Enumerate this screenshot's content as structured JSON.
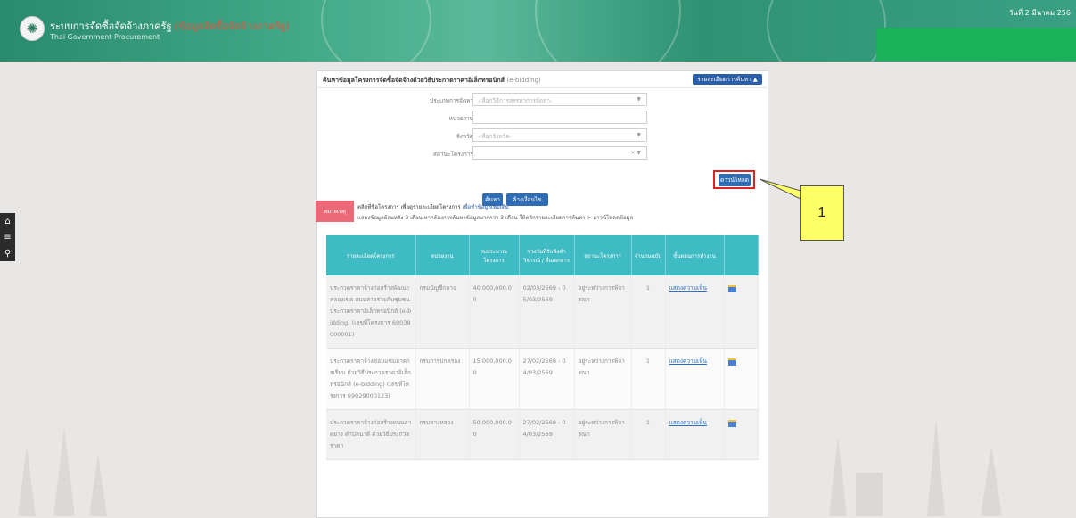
{
  "header": {
    "title_main": "ระบบการจัดซื้อจัดจ้างภาครัฐ",
    "title_red": "(ข้อมูลจัดซื้อจัดจ้างภาครัฐ)",
    "subtitle": "Thai Government Procurement",
    "date": "วันที่ 2 มีนาคม 256"
  },
  "sidenav": {
    "icons": [
      "home-icon",
      "menu-icon",
      "search-icon"
    ]
  },
  "panel": {
    "title": "ค้นหาข้อมูลโครงการจัดซื้อจัดจ้างด้วยวิธีประกวดราคาอิเล็กทรอนิกส์",
    "title_suffix": "(e-bidding)",
    "toggle_label": "รายละเอียดการค้นหา ▲",
    "form": {
      "method_label": "ประเภทการจัดหา",
      "method_placeholder": "-เลือกวิธีการสรรหาการจัดหา-",
      "agency_label": "หน่วยงาน",
      "agency_value": "",
      "province_label": "จังหวัด",
      "province_placeholder": "-เลือกจังหวัด-",
      "status_label": "สถานะโครงการ",
      "status_value": ""
    },
    "search_label": "ค้นหา",
    "clear_label": "ล้างเงื่อนไข",
    "download_label": "ดาวน์โหลด",
    "note_tag": "หมายเหตุ",
    "note_line1_a": "คลิกที่ชื่อโครงการ",
    "note_line1_b": "เพื่อดูรายละเอียดโครงการ",
    "note_line1_c": "เพื่อทำข้อมูลเพิ่มเติม",
    "note_line2": "แสดงข้อมูลย้อนหลัง 3 เดือน หากต้องการค้นหาข้อมูลมากกว่า 3 เดือน ให้คลิกรายละเอียดการค้นหา > ดาวน์โหลดข้อมูล"
  },
  "table": {
    "headers": [
      "รายละเอียดโครงการ",
      "หน่วยงาน",
      "งบประมาณโครงการ",
      "ช่วงวันที่รับฟังคำวิจารณ์ / ยื่นเอกสาร",
      "สถานะโครงการ",
      "จำนวนฉบับ",
      "ขั้นตอนการทำงาน",
      ""
    ],
    "rows": [
      {
        "detail": "ประกวดราคาจ้างก่อสร้างพัฒนาคลองเขต ถนนสายร่วมกับชุมชน ประกวดราคาอิเล็กทรอนิกส์ (e-bidding) (เลขที่โครงการ 69039000001)",
        "agency": "กรมบัญชีกลาง",
        "budget": "40,000,000.00",
        "dates": "02/03/2569 - 05/03/2569",
        "status": "อยู่ระหว่างการพิจารณา",
        "count": "1",
        "step": "แสดงความเห็น"
      },
      {
        "detail": "ประกวดราคาจ้างซ่อมแซมอาคารเรียน ด้วยวิธีประกวดราคาอิเล็กทรอนิกส์ (e-bidding) (เลขที่โครงการ 69029000123)",
        "agency": "กรมการปกครอง",
        "budget": "15,000,000.00",
        "dates": "27/02/2569 - 04/03/2569",
        "status": "อยู่ระหว่างการพิจารณา",
        "count": "1",
        "step": "แสดงความเห็น"
      },
      {
        "detail": "ประกวดราคาจ้างก่อสร้างถนนลาดยาง ตำบลนาดี ด้วยวิธีประกวดราคา",
        "agency": "กรมทางหลวง",
        "budget": "50,000,000.00",
        "dates": "27/02/2569 - 04/03/2569",
        "status": "อยู่ระหว่างการพิจารณา",
        "count": "1",
        "step": "แสดงความเห็น"
      }
    ]
  },
  "callout": {
    "label": "1"
  }
}
